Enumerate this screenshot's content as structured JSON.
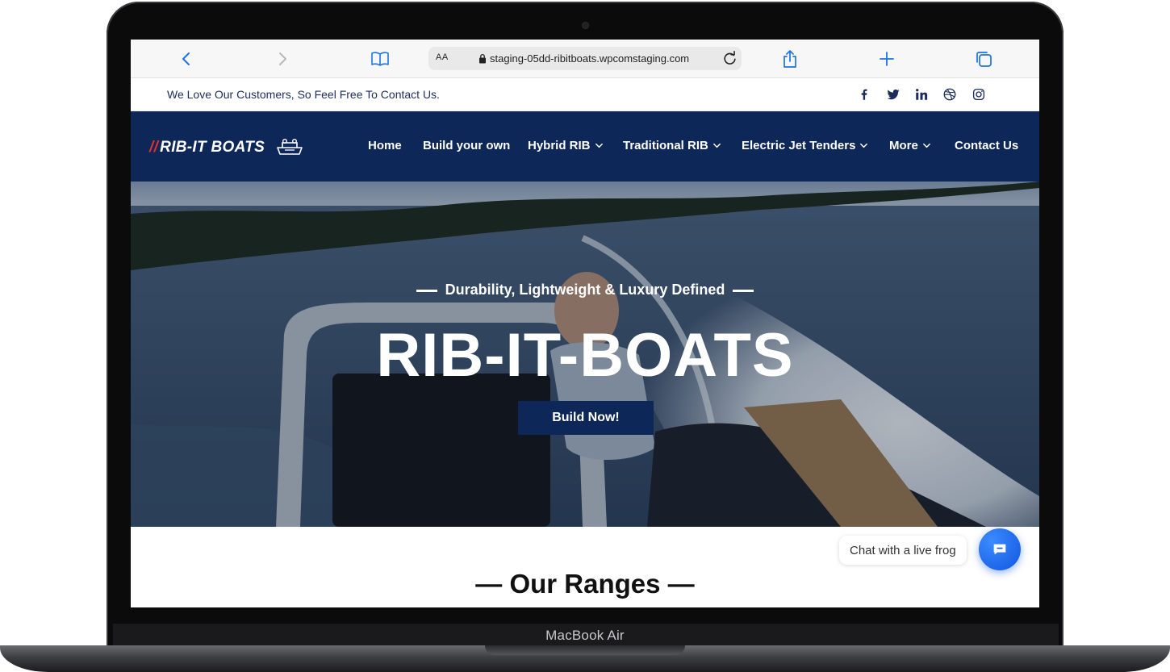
{
  "browser": {
    "url_aa": "AA",
    "url": "staging-05dd-ribitboats.wpcomstaging.com",
    "icons": [
      "back-icon",
      "forward-icon",
      "bookmarks-icon",
      "lock-icon",
      "reload-icon",
      "share-icon",
      "new-tab-icon",
      "tabs-icon"
    ]
  },
  "topbar": {
    "text": "We Love Our Customers, So Feel Free To Contact Us.",
    "social_icons": [
      "facebook-icon",
      "twitter-icon",
      "linkedin-icon",
      "dribbble-icon",
      "instagram-icon"
    ]
  },
  "navbar": {
    "logo_slash": "//",
    "logo_text": "RIB-IT BOATS",
    "items": [
      {
        "label": "Home",
        "dropdown": false
      },
      {
        "label": "Build your own",
        "dropdown": false
      },
      {
        "label": "Hybrid RIB",
        "dropdown": true
      },
      {
        "label": "Traditional RIB",
        "dropdown": true
      },
      {
        "label": "Electric Jet Tenders",
        "dropdown": true
      },
      {
        "label": "More",
        "dropdown": true
      },
      {
        "label": "Contact Us",
        "dropdown": false
      }
    ]
  },
  "hero": {
    "subtitle": "Durability, Lightweight & Luxury Defined",
    "title": "RIB-IT-BOATS",
    "cta": "Build Now!"
  },
  "section": {
    "ranges_title": "— Our Ranges —"
  },
  "chat": {
    "label": "Chat with a live frog"
  },
  "device": {
    "model": "MacBook Air"
  },
  "colors": {
    "navy": "#0e2759",
    "logo_accent": "#e0312f",
    "chat_blue": "#1156e0"
  }
}
